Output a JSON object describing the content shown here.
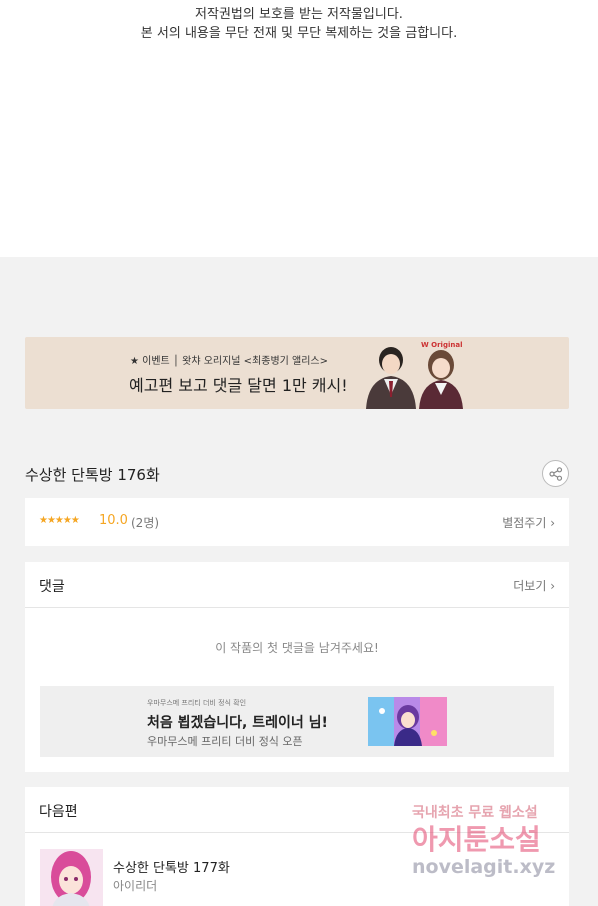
{
  "copyright": {
    "line1": "저작권법의 보호를 받는 저작물입니다.",
    "line2": "본 서의 내용을 무단 전재 및 무단 복제하는 것을 금합니다."
  },
  "banner": {
    "small_text": "★ 이벤트 │ 왓챠 오리지널 <최종병기 앨리스>",
    "big_text": "예고편 보고 댓글 달면 1만 캐시!",
    "logo_text": "W Original"
  },
  "episode": {
    "title": "수상한 단톡방 176화"
  },
  "rating": {
    "stars": "★★★★★",
    "score": "10.0",
    "count": "(2명)",
    "rate_label": "별점주기 ›"
  },
  "comments": {
    "heading": "댓글",
    "more_label": "더보기 ›",
    "empty_text": "이 작품의 첫 댓글을 남겨주세요!",
    "ad": {
      "small": "우마무스메 프리티 더비 정식 확인",
      "title": "처음 뵙겠습니다, 트레이너 님!",
      "subtitle": "우마무스메 프리티 더비 정식 오픈"
    }
  },
  "next": {
    "heading": "다음편",
    "title": "수상한 단톡방 177화",
    "author": "아이리더"
  },
  "watermark": {
    "line1": "국내최초 무료 웹소설",
    "line2": "아지툰소설",
    "line3": "novelagit.xyz"
  },
  "colors": {
    "accent_star": "#f5a623",
    "banner_bg": "#ecdfd2",
    "page_bg": "#f2f2f2"
  }
}
